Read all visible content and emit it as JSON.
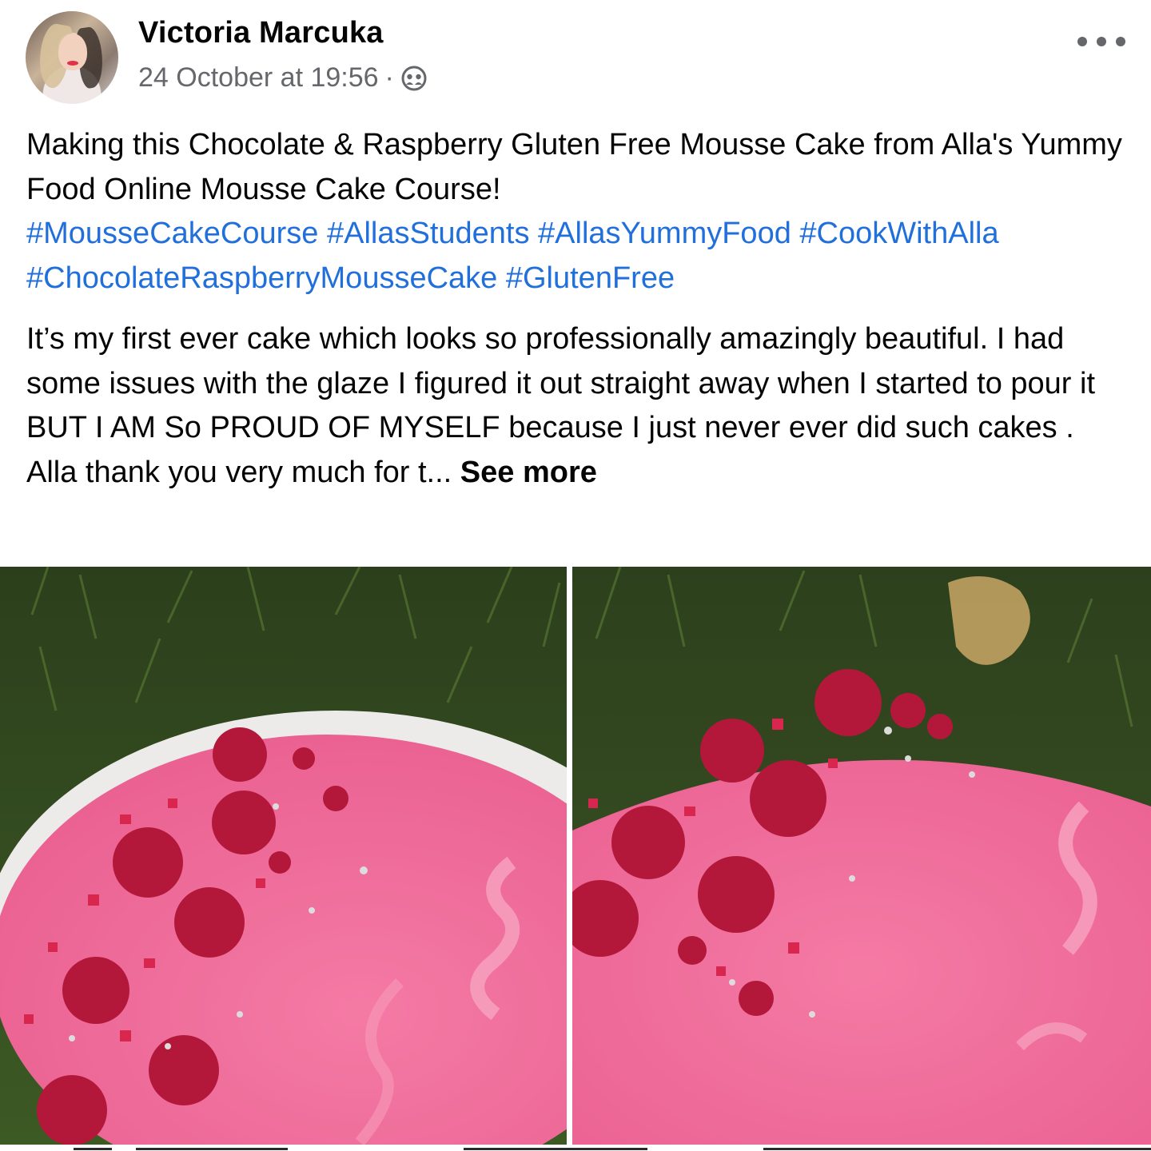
{
  "post": {
    "author": {
      "name": "Victoria Marcuka"
    },
    "timestamp": "24 October at 19:56",
    "separator": "·",
    "privacy_icon": "friends-icon",
    "more_icon": "more-horizontal-icon",
    "text": {
      "line1": "Making this Chocolate & Raspberry Gluten Free Mousse Cake from Alla's Yummy Food Online Mousse Cake Course!",
      "hashtags": [
        "#MousseCakeCourse",
        "#AllasStudents",
        "#AllasYummyFood",
        "#CookWithAlla",
        "#ChocolateRaspberryMousseCake",
        "#GlutenFree"
      ],
      "paragraph2": "It’s my first ever cake which looks so professionally amazingly beautiful. I had some issues with the glaze I figured it out straight away when I started to pour it BUT I AM So PROUD OF MYSELF because I just never ever did such cakes . Alla thank you very much for t...",
      "see_more": "See more"
    },
    "colors": {
      "hashtag": "#216fdb",
      "secondary_text": "#65676b",
      "cake_pink": "#f26e9c",
      "raspberry": "#b3183a",
      "grass": "#2f4a1e"
    }
  }
}
